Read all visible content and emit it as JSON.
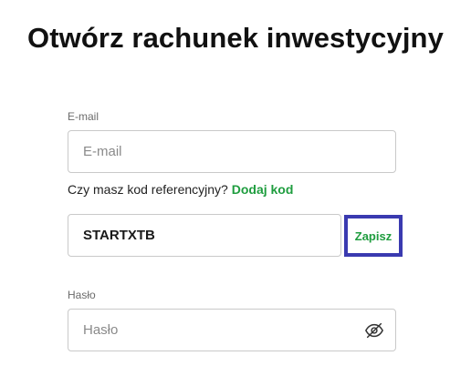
{
  "page_title": "Otwórz rachunek inwestycyjny",
  "email": {
    "label": "E-mail",
    "placeholder": "E-mail",
    "value": ""
  },
  "referral": {
    "question": "Czy masz kod referencyjny?",
    "link_label": "Dodaj kod",
    "code_value": "STARTXTB",
    "save_label": "Zapisz"
  },
  "password": {
    "label": "Hasło",
    "placeholder": "Hasło",
    "toggle_icon": "eye-slash-icon"
  },
  "colors": {
    "accent_green": "#1f9d3f",
    "highlight_border": "#3a3ab0"
  }
}
